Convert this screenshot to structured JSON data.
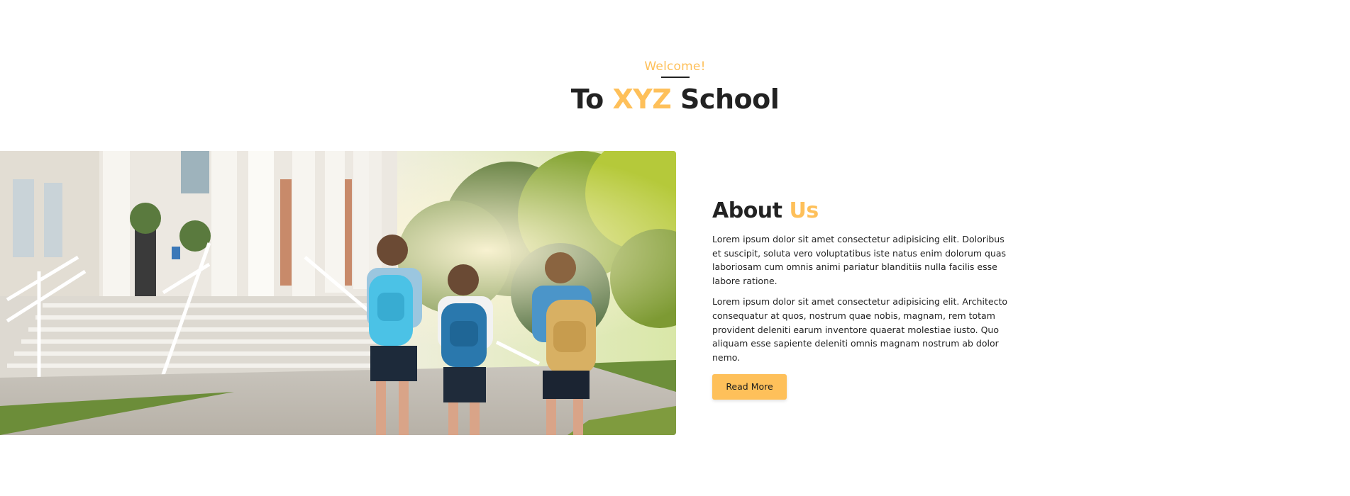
{
  "colors": {
    "accent": "#fec05a",
    "text_dark": "#222222",
    "underline": "#222222"
  },
  "hero": {
    "welcome": "Welcome!",
    "title_prefix": "To ",
    "title_highlight": "XYZ",
    "title_suffix": " School"
  },
  "image": {
    "icon": "school-children-photo",
    "alt": "Three children with backpacks walking toward a school building"
  },
  "about": {
    "title_main": "About ",
    "title_highlight": "Us",
    "paragraph1": "Lorem ipsum dolor sit amet consectetur adipisicing elit. Doloribus et suscipit, soluta vero voluptatibus iste natus enim dolorum quas laboriosam cum omnis animi pariatur blanditiis nulla facilis esse labore ratione.",
    "paragraph2": "Lorem ipsum dolor sit amet consectetur adipisicing elit. Architecto consequatur at quos, nostrum quae nobis, magnam, rem totam provident deleniti earum inventore quaerat molestiae iusto. Quo aliquam esse sapiente deleniti omnis magnam nostrum ab dolor nemo.",
    "button_label": "Read More"
  }
}
